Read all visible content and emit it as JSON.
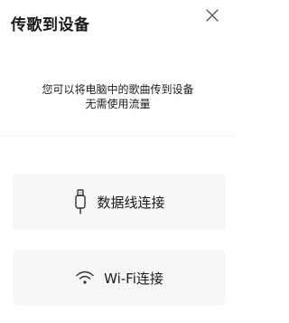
{
  "dialog": {
    "title": "传歌到设备",
    "close_icon": "close-icon",
    "description_line1": "您可以将电脑中的歌曲传到设备",
    "description_line2": "无需使用流量"
  },
  "options": {
    "usb": {
      "label": "数据线连接",
      "icon": "usb-cable-icon"
    },
    "wifi": {
      "label": "Wi-Fi连接",
      "icon": "wifi-icon"
    }
  },
  "colors": {
    "text": "#1a1a1a",
    "button_bg": "#f7f7f7",
    "divider": "#f0f0f0",
    "icon": "#333333"
  }
}
